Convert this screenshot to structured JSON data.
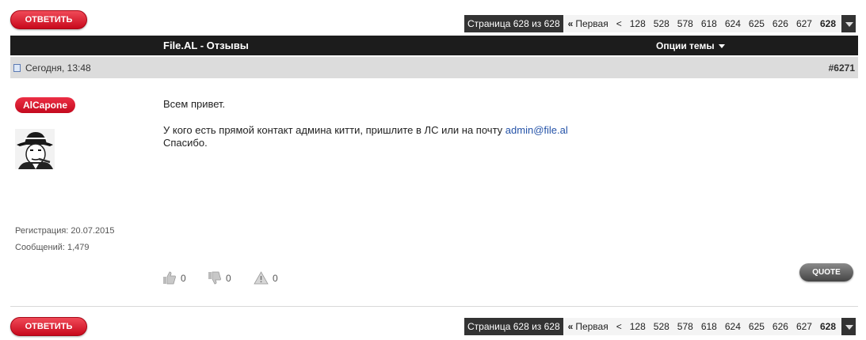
{
  "reply_label": "ОТВЕТИТЬ",
  "pagination": {
    "info": "Страница 628 из 628",
    "first_arrow": "«",
    "first": "Первая",
    "prev": "<",
    "pages": [
      "128",
      "528",
      "578",
      "618",
      "624",
      "625",
      "626",
      "627",
      "628"
    ],
    "current": "628"
  },
  "thread": {
    "title": "File.AL - Отзывы",
    "options_label": "Опции темы"
  },
  "post": {
    "date": "Сегодня, 13:48",
    "number": "#6271",
    "author": "AlCapone",
    "registration": "Регистрация: 20.07.2015",
    "messages": "Сообщений: 1,479",
    "content": {
      "line1": "Всем привет.",
      "line2": "У кого есть прямой контакт админа китти, пришлите в ЛС или на почту",
      "email": "admin@file.al",
      "line3": "Спасибо."
    },
    "likes": "0",
    "dislikes": "0",
    "reports": "0",
    "quote_label": "QUOTE"
  },
  "colors": {
    "accent_red": "#d3132a",
    "bar_dark": "#1c1c1c",
    "date_bar": "#dcdcdc",
    "link": "#2553a8"
  },
  "icons": [
    "post-icon",
    "thumbs-up-icon",
    "thumbs-down-icon",
    "warning-icon",
    "dropdown-arrow-icon"
  ]
}
